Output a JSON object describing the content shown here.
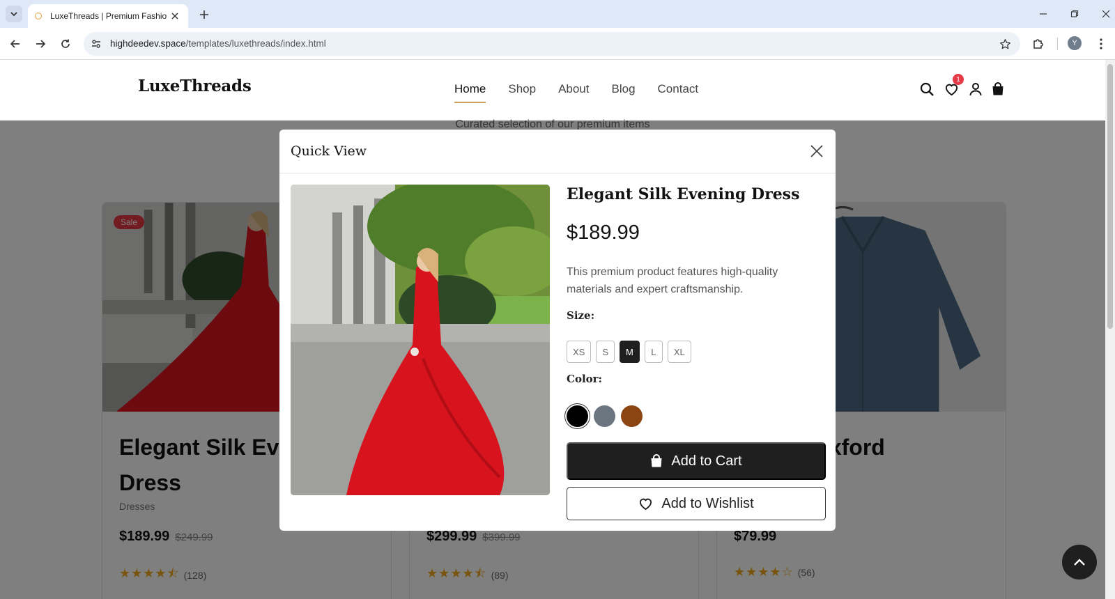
{
  "browser": {
    "tab_title": "LuxeThreads | Premium Fashion",
    "url_host": "highdeedev.space",
    "url_path": "/templates/luxethreads/index.html",
    "profile_initial": "Y"
  },
  "site": {
    "logo": "LuxeThreads",
    "nav": [
      "Home",
      "Shop",
      "About",
      "Blog",
      "Contact"
    ],
    "active_nav": "Home",
    "wishlist_count": "1",
    "section_subtitle": "Curated selection of our premium items"
  },
  "products": [
    {
      "badge": "Sale",
      "title": "Elegant Silk Evening Dress",
      "category": "Dresses",
      "price": "$189.99",
      "old_price": "$249.99",
      "rating": 4.5,
      "reviews": "(128)"
    },
    {
      "title": "",
      "category": "",
      "price": "$299.99",
      "old_price": "$399.99",
      "rating": 4.5,
      "reviews": "(89)"
    },
    {
      "title": "Cotton Oxford",
      "category": "",
      "price": "$79.99",
      "old_price": "",
      "rating": 4,
      "reviews": "(56)"
    }
  ],
  "quick_view": {
    "heading": "Quick View",
    "name": "Elegant Silk Evening Dress",
    "price": "$189.99",
    "description": "This premium product features high-quality materials and expert craftsmanship.",
    "size_label": "Size:",
    "sizes": [
      "XS",
      "S",
      "M",
      "L",
      "XL"
    ],
    "selected_size": "M",
    "color_label": "Color:",
    "colors": [
      "#000000",
      "#6c7681",
      "#8b4513"
    ],
    "selected_color": "#000000",
    "add_to_cart": "Add to Cart",
    "add_to_wishlist": "Add to Wishlist"
  },
  "icons": {
    "search": "search-icon",
    "wishlist": "heart-icon",
    "account": "user-icon",
    "cart": "shopping-bag-icon",
    "close": "close-icon",
    "back_to_top": "chevron-up-icon"
  }
}
